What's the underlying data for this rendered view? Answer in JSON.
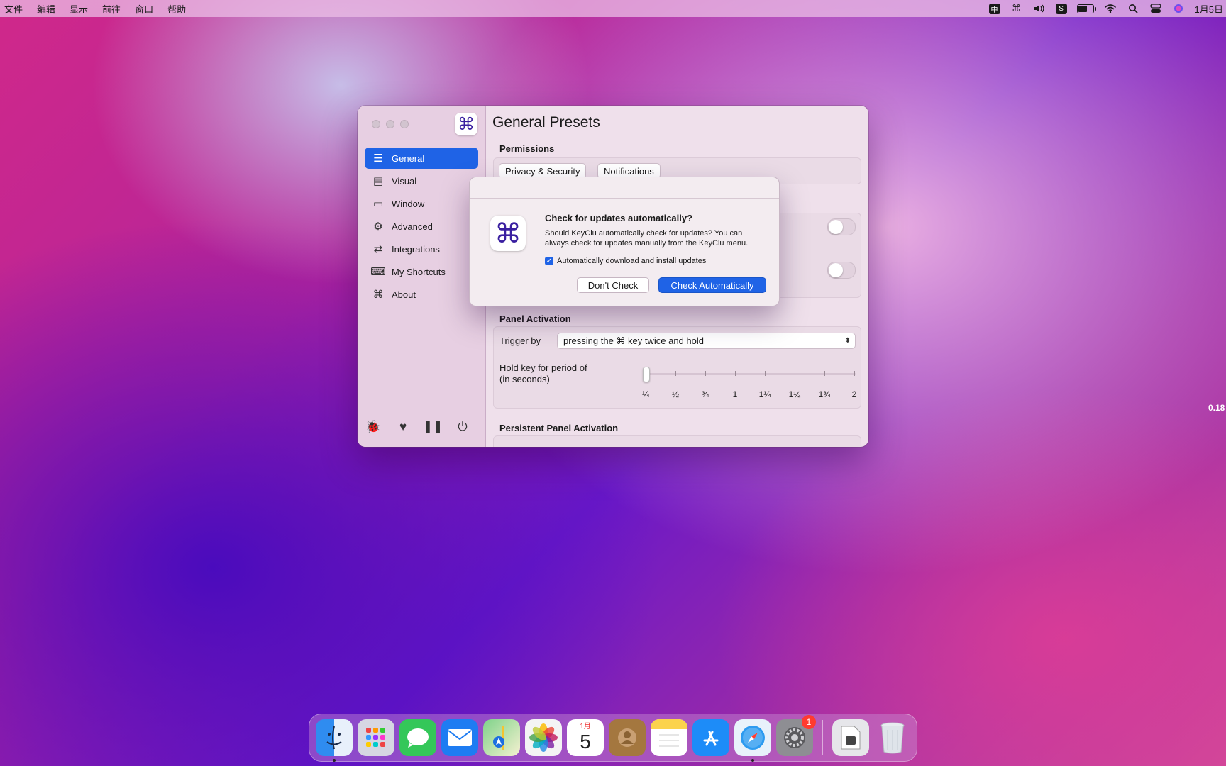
{
  "menubar": {
    "menus": [
      "文件",
      "编辑",
      "显示",
      "前往",
      "窗口",
      "帮助"
    ],
    "status_icons": [
      "input-method-icon",
      "command-icon",
      "volume-icon",
      "s-app-icon",
      "battery-icon",
      "wifi-icon",
      "search-icon",
      "control-center-icon",
      "siri-icon"
    ],
    "input_method_label": "中",
    "clock": "1月5日"
  },
  "window": {
    "title": "General Presets",
    "sidebar": {
      "items": [
        {
          "label": "General",
          "icon": "list-icon",
          "active": true
        },
        {
          "label": "Visual",
          "icon": "layout-icon",
          "active": false
        },
        {
          "label": "Window",
          "icon": "window-icon",
          "active": false
        },
        {
          "label": "Advanced",
          "icon": "gears-icon",
          "active": false
        },
        {
          "label": "Integrations",
          "icon": "sync-icon",
          "active": false
        },
        {
          "label": "My Shortcuts",
          "icon": "keyboard-icon",
          "active": false
        },
        {
          "label": "About",
          "icon": "command-icon",
          "active": false
        }
      ],
      "footer_icons": [
        "bug-icon",
        "heart-icon",
        "pause-icon",
        "power-icon"
      ]
    },
    "permissions": {
      "label": "Permissions",
      "buttons": [
        "Privacy & Security",
        "Notifications"
      ]
    },
    "panel_activation": {
      "label": "Panel Activation",
      "trigger_label": "Trigger by",
      "trigger_value": "pressing the ⌘ key twice and hold",
      "hold_label_line1": "Hold key for period of",
      "hold_label_line2": "(in seconds)",
      "slider_ticks": [
        "¼",
        "½",
        "¾",
        "1",
        "1¼",
        "1½",
        "1¾",
        "2"
      ],
      "slider_value": 0.18
    },
    "persistent_panel": {
      "label": "Persistent Panel Activation"
    }
  },
  "dialog": {
    "title": "Check for updates automatically?",
    "body": "Should KeyClu automatically check for updates? You can always check for updates manually from the KeyClu menu.",
    "checkbox_label": "Automatically download and install updates",
    "checkbox_checked": true,
    "secondary_button": "Don't Check",
    "primary_button": "Check Automatically"
  },
  "edge_text": "0.18",
  "dock": {
    "apps": [
      {
        "name": "finder-icon",
        "color": "#2f8cf0",
        "running": true
      },
      {
        "name": "launchpad-icon",
        "color": "#c8c8d8"
      },
      {
        "name": "messages-icon",
        "color": "#34c759"
      },
      {
        "name": "mail-icon",
        "color": "#1e7cf2"
      },
      {
        "name": "maps-icon",
        "color": "#5fbf6a"
      },
      {
        "name": "photos-icon",
        "color": "#f4f4f4"
      },
      {
        "name": "calendar-icon",
        "color": "#ffffff"
      },
      {
        "name": "contacts-icon",
        "color": "#a4773f"
      },
      {
        "name": "notes-icon",
        "color": "#fbd34d"
      },
      {
        "name": "app-store-icon",
        "color": "#1d8cf8"
      },
      {
        "name": "safari-icon",
        "color": "#e8f2fb",
        "running": true
      },
      {
        "name": "system-settings-icon",
        "color": "#8e8e93",
        "badge": "1"
      }
    ],
    "calendar_month": "1月",
    "calendar_day": "5",
    "right_items": [
      {
        "name": "downloads-stack-icon",
        "color": "#e6e6ea"
      },
      {
        "name": "trash-icon",
        "color": "#d9dde3"
      }
    ]
  }
}
